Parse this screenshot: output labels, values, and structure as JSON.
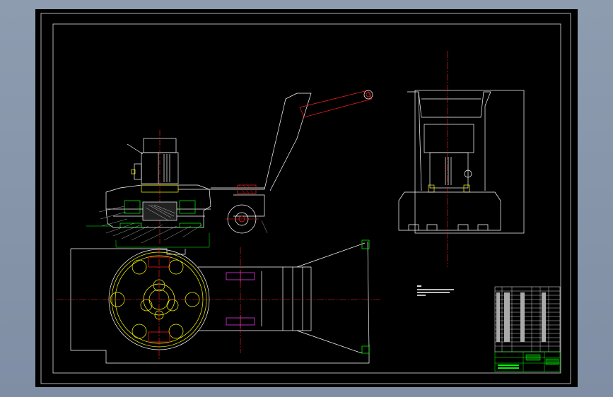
{
  "canvas": {
    "background": "#000000",
    "frame_color": "#ffffff",
    "centerline_color": "#ff2020",
    "part_color": "#ffff00",
    "bolt_color": "#ff40ff",
    "dimension_color": "#00ff00",
    "outline_color": "#ffffff"
  },
  "views": [
    "front-elevation",
    "side-elevation",
    "plan-view"
  ],
  "technical_notes": {
    "visible": true,
    "legible": false
  },
  "title_block": {
    "visible": true,
    "legible": false
  },
  "icons": {
    "motor": "motor-icon",
    "wheel": "wheel-icon",
    "handle": "handle-icon"
  }
}
